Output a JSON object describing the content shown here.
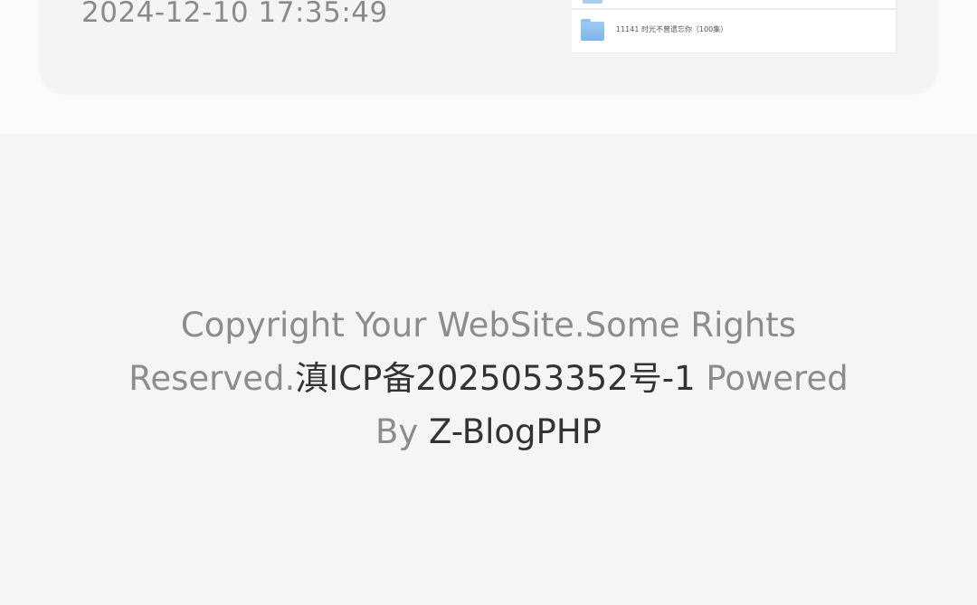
{
  "post": {
    "date": "2024-12-10 17:35:49",
    "thumbnail": {
      "folder_icon": "folder-icon",
      "file_name": "11141 时光不曾遗忘你（100集）"
    }
  },
  "footer": {
    "copyright_part1": "Copyright Your WebSite.Some Rights",
    "copyright_part2": "Reserved.",
    "icp_link": "滇ICP备2025053352号-1",
    "powered_text": " Powered",
    "by_text": "By ",
    "zblog_link": "Z-BlogPHP"
  },
  "colors": {
    "page_background": "#f5f5f5",
    "card_background": "#f4f4f4",
    "muted_text": "#8c8c8c",
    "link_text": "#333333",
    "folder_blue": "#8ec0ec"
  }
}
